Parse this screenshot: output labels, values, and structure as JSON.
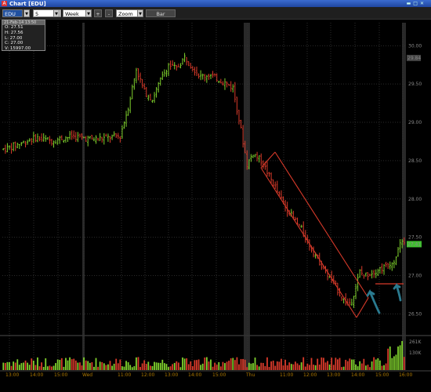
{
  "window": {
    "title": "Chart [EDU]",
    "app_icon": "A",
    "controls_icon": "window-controls"
  },
  "toolbar": {
    "symbol": "EDU",
    "interval": "5 minutes",
    "range": "Week",
    "plus_label": "+",
    "minus_label": "-",
    "zoom_label": "Zoom",
    "chart_type_label": "Bar"
  },
  "info_box": {
    "header": "21-Feb-14 13:50",
    "open": "O: 27.51",
    "high": "H: 27.56",
    "low": "L: 27.00",
    "close": "C: 27.00",
    "volume": "V: 15997.00"
  },
  "colors": {
    "up": "#7fd12d",
    "down": "#d83a2a",
    "channel": "#d83a2a",
    "arrow": "#2a7a8f",
    "grid": "#2b2b2b",
    "session_sep": "#555555"
  },
  "chart_data": {
    "type": "bar",
    "symbol": "EDU",
    "interval": "5 minutes",
    "price_axis": {
      "ticks": [
        "30.00",
        "29.50",
        "29.00",
        "28.50",
        "28.00",
        "27.50",
        "27.00",
        "26.50"
      ],
      "ylim": [
        26.35,
        30.3
      ],
      "last_price_label": "27.41",
      "marker_label": "29.84"
    },
    "volume_axis": {
      "ticks": [
        "261K",
        "130K"
      ],
      "ylim": [
        0,
        261000
      ]
    },
    "time_axis": {
      "labels": [
        "13:00",
        "14:00",
        "15:00",
        "Wed",
        "11:00",
        "12:00",
        "13:00",
        "14:00",
        "15:00",
        "Thu",
        "11:00",
        "12:00",
        "13:00",
        "14:00",
        "15:00",
        "16:00"
      ]
    },
    "price_path": [
      [
        0,
        28.65
      ],
      [
        8,
        28.72
      ],
      [
        16,
        28.8
      ],
      [
        24,
        28.76
      ],
      [
        34,
        28.82
      ],
      [
        44,
        28.78
      ],
      [
        52,
        28.8
      ],
      [
        58,
        28.82
      ],
      [
        62,
        29.2
      ],
      [
        66,
        29.7
      ],
      [
        70,
        29.4
      ],
      [
        74,
        29.3
      ],
      [
        78,
        29.55
      ],
      [
        82,
        29.75
      ],
      [
        86,
        29.7
      ],
      [
        90,
        29.85
      ],
      [
        94,
        29.72
      ],
      [
        98,
        29.6
      ],
      [
        102,
        29.62
      ],
      [
        108,
        29.55
      ],
      [
        114,
        29.45
      ],
      [
        118,
        28.9
      ],
      [
        121,
        28.45
      ],
      [
        124,
        28.6
      ],
      [
        128,
        28.5
      ],
      [
        132,
        28.3
      ],
      [
        136,
        28.1
      ],
      [
        140,
        27.9
      ],
      [
        144,
        27.75
      ],
      [
        148,
        27.6
      ],
      [
        152,
        27.4
      ],
      [
        156,
        27.22
      ],
      [
        160,
        27.05
      ],
      [
        164,
        26.9
      ],
      [
        168,
        26.72
      ],
      [
        171,
        26.62
      ],
      [
        173,
        26.68
      ],
      [
        175,
        26.85
      ],
      [
        177,
        27.05
      ],
      [
        179,
        27.0
      ],
      [
        182,
        27.03
      ],
      [
        186,
        27.08
      ],
      [
        190,
        27.12
      ],
      [
        194,
        27.2
      ],
      [
        197,
        27.41
      ]
    ],
    "channel": {
      "upper": [
        [
          351,
          194
        ],
        [
          470,
          380
        ]
      ],
      "lower": [
        [
          333,
          214
        ],
        [
          455,
          405
        ]
      ]
    },
    "annotations": [
      "channel",
      "arrow",
      "arrow",
      "support-line"
    ]
  }
}
